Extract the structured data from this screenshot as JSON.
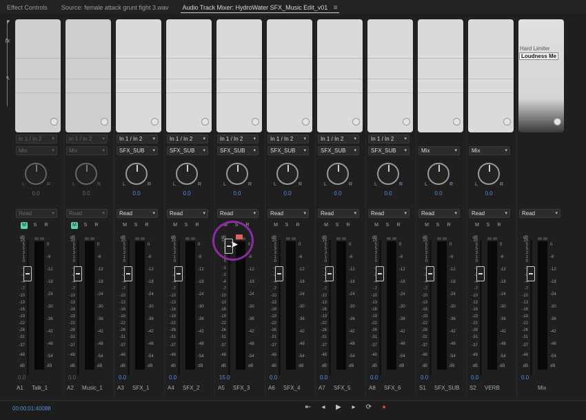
{
  "tabs": [
    {
      "label": "Effect Controls",
      "active": false
    },
    {
      "label": "Source: female attack grunt fight 3.wav",
      "active": false
    },
    {
      "label": "Audio Track Mixer: HydroWater SFX_Music Edit_v01",
      "active": true
    }
  ],
  "tab_menu_icon": "hamburger-icon",
  "rail": {
    "fx_label": "fx"
  },
  "scale_left": [
    "dB",
    "15",
    "5",
    "5",
    "3",
    "1",
    "0",
    "-1",
    "-2",
    "-4",
    "-7",
    "-10",
    "-13",
    "-16",
    "-19",
    "-22",
    "-26",
    "-31",
    "-37",
    "-48",
    "dB"
  ],
  "scale_right": [
    "0",
    "-6",
    "-12",
    "-18",
    "-24",
    "-30",
    "-36",
    "-42",
    "-48",
    "-54",
    "dB"
  ],
  "master": {
    "effects": [
      "Hard Limiter",
      "Loudness Me"
    ],
    "automation": "Read",
    "db_value": "0.0",
    "name": "Mix"
  },
  "tracks": [
    {
      "id": "A1",
      "name": "Talk_1",
      "input": "In 1 / In 2",
      "output": "Mix",
      "pan": "0.0",
      "automation": "Read",
      "mute": true,
      "db_value": "0.0",
      "dim": true
    },
    {
      "id": "A2",
      "name": "Music_1",
      "input": "In 1 / In 2",
      "output": "Mix",
      "pan": "0.0",
      "automation": "Read",
      "mute": true,
      "db_value": "0.0",
      "dim": true
    },
    {
      "id": "A3",
      "name": "SFX_1",
      "input": "In 1 / In 2",
      "output": "SFX_SUB",
      "pan": "0.0",
      "automation": "Read",
      "mute": false,
      "db_value": "0.0",
      "dim": false
    },
    {
      "id": "A4",
      "name": "SFX_2",
      "input": "In 1 / In 2",
      "output": "SFX_SUB",
      "pan": "0.0",
      "automation": "Read",
      "mute": false,
      "db_value": "0.0",
      "dim": false
    },
    {
      "id": "A5",
      "name": "SFX_3",
      "input": "In 1 / In 2",
      "output": "SFX_SUB",
      "pan": "0.0",
      "automation": "Read",
      "mute": false,
      "db_value": "15.0",
      "dim": false
    },
    {
      "id": "A6",
      "name": "SFX_4",
      "input": "In 1 / In 2",
      "output": "SFX_SUB",
      "pan": "0.0",
      "automation": "Read",
      "mute": false,
      "db_value": "0.0",
      "dim": false
    },
    {
      "id": "A7",
      "name": "SFX_5",
      "input": "In 1 / In 2",
      "output": "SFX_SUB",
      "pan": "0.0",
      "automation": "Read",
      "mute": false,
      "db_value": "0.0",
      "dim": false
    },
    {
      "id": "A8",
      "name": "SFX_6",
      "input": "In 1 / In 2",
      "output": "SFX_SUB",
      "pan": "0.0",
      "automation": "Read",
      "mute": false,
      "db_value": "0.0",
      "dim": false
    },
    {
      "id": "S1",
      "name": "SFX_SUB",
      "input": "",
      "output": "Mix",
      "pan": "0.0",
      "automation": "Read",
      "mute": false,
      "db_value": "0.0",
      "dim": false
    },
    {
      "id": "S2",
      "name": "VERB",
      "input": "",
      "output": "Mix",
      "pan": "0.0",
      "automation": "Read",
      "mute": false,
      "db_value": "0.0",
      "dim": false
    }
  ],
  "msr_labels": {
    "m": "M",
    "s": "S",
    "r": "R"
  },
  "knob_labels": {
    "l": "L",
    "r": "R"
  },
  "timecode": "00:00:01:40088",
  "transport": [
    {
      "name": "go-to-in-icon",
      "glyph": "⇤"
    },
    {
      "name": "go-to-prev-icon",
      "glyph": "◂"
    },
    {
      "name": "play-icon",
      "glyph": "▶"
    },
    {
      "name": "go-to-next-icon",
      "glyph": "▸"
    },
    {
      "name": "loop-icon",
      "glyph": "⟳"
    },
    {
      "name": "record-icon",
      "glyph": "●"
    }
  ]
}
